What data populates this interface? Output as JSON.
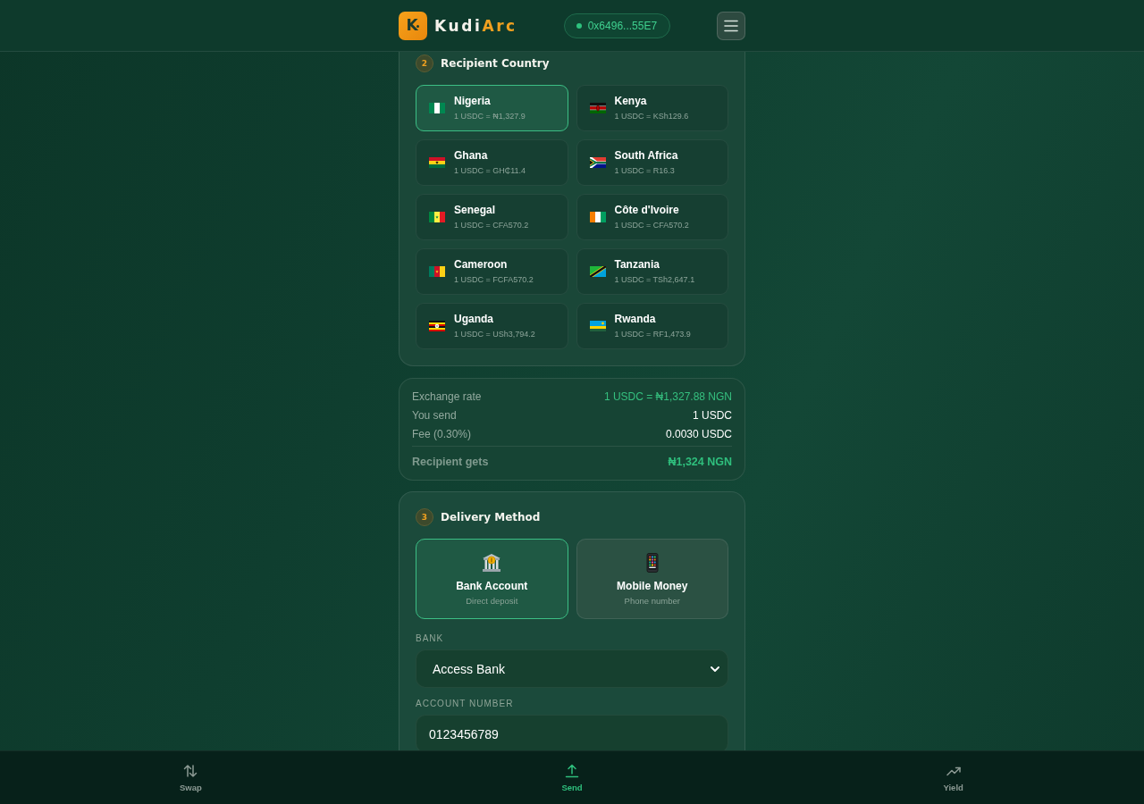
{
  "header": {
    "logo": {
      "mark": "K",
      "name": "Kudi",
      "accent": "Arc"
    },
    "wallet": {
      "address": "0x6496...55E7",
      "connected": true
    }
  },
  "recipient_country": {
    "step": "2",
    "title": "Recipient Country",
    "countries": [
      {
        "name": "Nigeria",
        "rate": "1 USDC = ₦1,327.9",
        "selected": true
      },
      {
        "name": "Kenya",
        "rate": "1 USDC = KSh129.6",
        "selected": false
      },
      {
        "name": "Ghana",
        "rate": "1 USDC = GH₵11.4",
        "selected": false
      },
      {
        "name": "South Africa",
        "rate": "1 USDC = R16.3",
        "selected": false
      },
      {
        "name": "Senegal",
        "rate": "1 USDC = CFA570.2",
        "selected": false
      },
      {
        "name": "Côte d'Ivoire",
        "rate": "1 USDC = CFA570.2",
        "selected": false
      },
      {
        "name": "Cameroon",
        "rate": "1 USDC = FCFA570.2",
        "selected": false
      },
      {
        "name": "Tanzania",
        "rate": "1 USDC = TSh2,647.1",
        "selected": false
      },
      {
        "name": "Uganda",
        "rate": "1 USDC = USh3,794.2",
        "selected": false
      },
      {
        "name": "Rwanda",
        "rate": "1 USDC = RF1,473.9",
        "selected": false
      }
    ]
  },
  "summary": {
    "rows": [
      {
        "label": "Exchange rate",
        "value": "1 USDC = ₦1,327.88 NGN",
        "kind": "highlight"
      },
      {
        "label": "You send",
        "value": "1 USDC",
        "kind": "plain"
      },
      {
        "label": "Fee (0.30%)",
        "value": "0.0030 USDC",
        "kind": "plain"
      }
    ],
    "total": {
      "label": "Recipient gets",
      "value": "₦1,324 NGN"
    }
  },
  "delivery_method": {
    "step": "3",
    "title": "Delivery Method",
    "options": [
      {
        "title": "Bank Account",
        "subtitle": "Direct deposit",
        "selected": true
      },
      {
        "title": "Mobile Money",
        "subtitle": "Phone number",
        "selected": false
      }
    ],
    "fields": [
      {
        "label": "BANK",
        "kind": "select",
        "value": "Access Bank"
      },
      {
        "label": "ACCOUNT NUMBER",
        "kind": "input",
        "value": "0123456789"
      }
    ]
  },
  "bottom_nav": {
    "items": [
      {
        "label": "Swap",
        "selected": false
      },
      {
        "label": "Send",
        "selected": true
      },
      {
        "label": "Yield",
        "selected": false
      }
    ]
  }
}
